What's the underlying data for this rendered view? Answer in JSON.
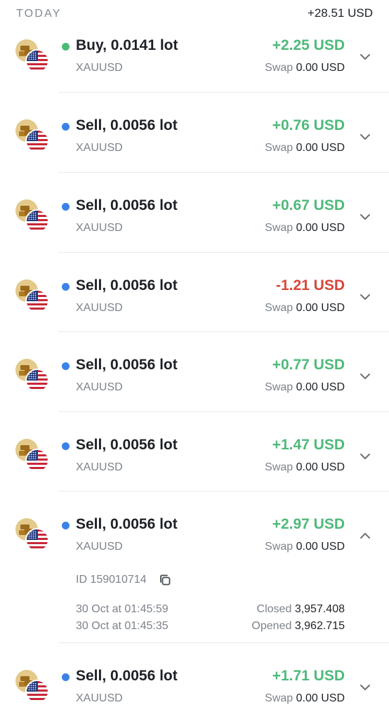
{
  "header": {
    "title": "TODAY",
    "total": "+28.51 USD"
  },
  "colors": {
    "profit": "#4fb97a",
    "loss": "#d8463a",
    "buy_dot": "#48bb78",
    "sell_dot": "#3b82e6"
  },
  "swap_label": "Swap",
  "trades": [
    {
      "side": "buy",
      "title": "Buy, 0.0141 lot",
      "symbol": "XAUUSD",
      "pnl": "+2.25 USD",
      "pnl_sign": "profit",
      "swap": "0.00 USD",
      "expanded": false,
      "icon": "chevron-down-icon"
    },
    {
      "side": "sell",
      "title": "Sell, 0.0056 lot",
      "symbol": "XAUUSD",
      "pnl": "+0.76 USD",
      "pnl_sign": "profit",
      "swap": "0.00 USD",
      "expanded": false,
      "icon": "chevron-down-icon"
    },
    {
      "side": "sell",
      "title": "Sell, 0.0056 lot",
      "symbol": "XAUUSD",
      "pnl": "+0.67 USD",
      "pnl_sign": "profit",
      "swap": "0.00 USD",
      "expanded": false,
      "icon": "chevron-down-icon"
    },
    {
      "side": "sell",
      "title": "Sell, 0.0056 lot",
      "symbol": "XAUUSD",
      "pnl": "-1.21 USD",
      "pnl_sign": "loss",
      "swap": "0.00 USD",
      "expanded": false,
      "icon": "chevron-down-icon"
    },
    {
      "side": "sell",
      "title": "Sell, 0.0056 lot",
      "symbol": "XAUUSD",
      "pnl": "+0.77 USD",
      "pnl_sign": "profit",
      "swap": "0.00 USD",
      "expanded": false,
      "icon": "chevron-down-icon"
    },
    {
      "side": "sell",
      "title": "Sell, 0.0056 lot",
      "symbol": "XAUUSD",
      "pnl": "+1.47 USD",
      "pnl_sign": "profit",
      "swap": "0.00 USD",
      "expanded": false,
      "icon": "chevron-down-icon"
    },
    {
      "side": "sell",
      "title": "Sell, 0.0056 lot",
      "symbol": "XAUUSD",
      "pnl": "+2.97 USD",
      "pnl_sign": "profit",
      "swap": "0.00 USD",
      "expanded": true,
      "icon": "chevron-up-icon",
      "details": {
        "id": "ID 159010714",
        "closed_time": "30 Oct at 01:45:59",
        "opened_time": "30 Oct at 01:45:35",
        "closed_label": "Closed",
        "closed_price": "3,957.408",
        "opened_label": "Opened",
        "opened_price": "3,962.715"
      }
    },
    {
      "side": "sell",
      "title": "Sell, 0.0056 lot",
      "symbol": "XAUUSD",
      "pnl": "+1.71 USD",
      "pnl_sign": "profit",
      "swap": "0.00 USD",
      "expanded": false,
      "icon": "chevron-down-icon"
    }
  ]
}
